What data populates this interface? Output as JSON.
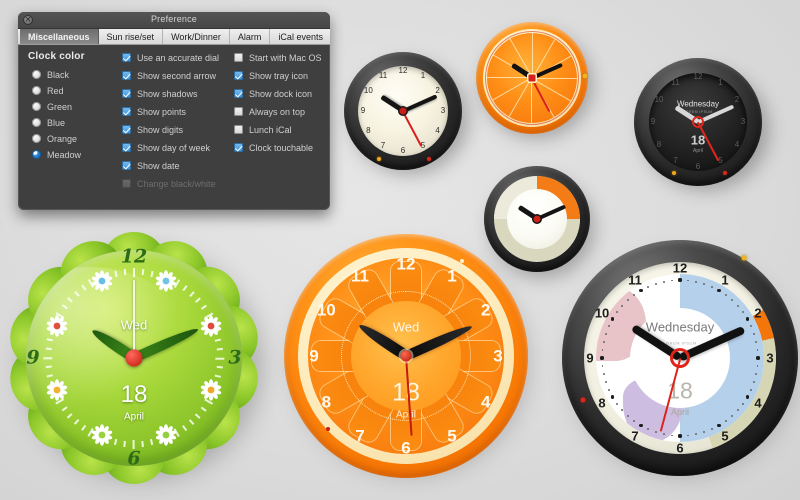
{
  "window": {
    "title": "Preference",
    "close_icon": "close-icon",
    "tabs": [
      {
        "label": "Miscellaneous",
        "active": true
      },
      {
        "label": "Sun rise/set",
        "active": false
      },
      {
        "label": "Work/Dinner",
        "active": false
      },
      {
        "label": "Alarm",
        "active": false
      },
      {
        "label": "iCal events",
        "active": false
      }
    ],
    "clock_color": {
      "title": "Clock color",
      "options": [
        {
          "label": "Black",
          "selected": false
        },
        {
          "label": "Red",
          "selected": false
        },
        {
          "label": "Green",
          "selected": false
        },
        {
          "label": "Blue",
          "selected": false
        },
        {
          "label": "Orange",
          "selected": false
        },
        {
          "label": "Meadow",
          "selected": true
        }
      ]
    },
    "middle_options": [
      {
        "label": "Use an accurate dial",
        "checked": true,
        "disabled": false
      },
      {
        "label": "Show second arrow",
        "checked": true,
        "disabled": false
      },
      {
        "label": "Show shadows",
        "checked": true,
        "disabled": false
      },
      {
        "label": "Show points",
        "checked": true,
        "disabled": false
      },
      {
        "label": "Show digits",
        "checked": true,
        "disabled": false
      },
      {
        "label": "Show day of week",
        "checked": true,
        "disabled": false
      },
      {
        "label": "Show date",
        "checked": true,
        "disabled": false
      },
      {
        "label": "Change black/white",
        "checked": false,
        "disabled": true
      }
    ],
    "right_options": [
      {
        "label": "Start with Mac OS",
        "checked": false,
        "disabled": false
      },
      {
        "label": "Show tray icon",
        "checked": true,
        "disabled": false
      },
      {
        "label": "Show dock icon",
        "checked": true,
        "disabled": false
      },
      {
        "label": "Always on top",
        "checked": false,
        "disabled": false
      },
      {
        "label": "Lunch iCal",
        "checked": false,
        "disabled": false
      },
      {
        "label": "Clock touchable",
        "checked": true,
        "disabled": false
      }
    ]
  },
  "colors": {
    "accent_blue": "#3a8dd0",
    "orange": "#f97a06",
    "meadow_green": "#89c328",
    "second_hand_red": "#d9201c",
    "panel_bg": "#3f3f3f",
    "desktop_bg": "#dcdcdc"
  },
  "clocks": [
    {
      "id": "clock-black-wall",
      "style": "black-cream",
      "digits": [
        "12",
        "1",
        "2",
        "3",
        "4",
        "5",
        "6",
        "7",
        "8",
        "9",
        "10",
        "11"
      ],
      "day": "",
      "date": "",
      "month": "",
      "hour_deg": 303,
      "minute_deg": 66,
      "second_deg": 152
    },
    {
      "id": "clock-orange-small",
      "style": "orange-slice",
      "digits": [],
      "day": "",
      "date": "",
      "month": "",
      "hour_deg": 303,
      "minute_deg": 66,
      "second_deg": 152
    },
    {
      "id": "clock-dark",
      "style": "dark",
      "digits": [
        "12",
        "1",
        "2",
        "3",
        "4",
        "5",
        "6",
        "7",
        "8",
        "9",
        "10",
        "11"
      ],
      "day": "Wednesday",
      "date": "18",
      "month": "April",
      "hour_deg": 303,
      "minute_deg": 66,
      "second_deg": 152
    },
    {
      "id": "clock-white-olive",
      "style": "white-olive",
      "digits": [],
      "day": "",
      "date": "",
      "month": "",
      "hour_deg": 303,
      "minute_deg": 66,
      "second_deg": 152
    },
    {
      "id": "clock-meadow-flower",
      "style": "meadow",
      "digits": [
        "12",
        "3",
        "6",
        "9"
      ],
      "day": "Wed",
      "date": "18",
      "month": "April",
      "hour_deg": 303,
      "minute_deg": 66,
      "second_deg": 0
    },
    {
      "id": "clock-orange-large",
      "style": "orange-slice-large",
      "digits": [
        "12",
        "1",
        "2",
        "3",
        "4",
        "5",
        "6",
        "7",
        "8",
        "9",
        "10",
        "11"
      ],
      "day": "Wed",
      "date": "18",
      "month": "April",
      "hour_deg": 303,
      "minute_deg": 66,
      "second_deg": 176
    },
    {
      "id": "clock-detailed-white",
      "style": "detailed-white",
      "digits": [
        "12",
        "1",
        "2",
        "3",
        "4",
        "5",
        "6",
        "7",
        "8",
        "9",
        "10",
        "11"
      ],
      "day": "Wednesday",
      "date": "18",
      "month": "April",
      "hour_deg": 303,
      "minute_deg": 66,
      "second_deg": 195
    }
  ]
}
